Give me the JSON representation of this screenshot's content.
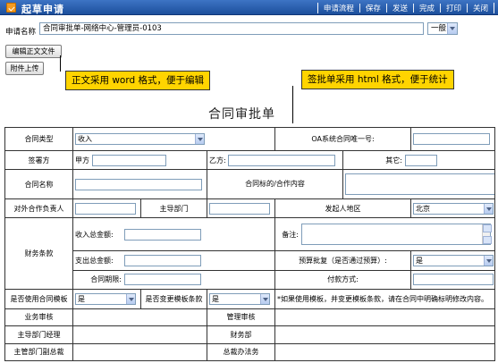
{
  "window": {
    "title": "起草申请"
  },
  "toolbar": {
    "items": [
      "申请流程",
      "保存",
      "发送",
      "完成",
      "打印",
      "关闭"
    ]
  },
  "header": {
    "app_name_label": "申请名称",
    "app_name_value": "合同审批单-网络中心-管理员-0103",
    "priority_value": "一般"
  },
  "buttons": {
    "edit_doc": "编辑正文文件",
    "attach": "附件上传"
  },
  "callouts": {
    "left": "正文采用 word 格式，便于编辑",
    "right": "签批单采用 html 格式，便于统计"
  },
  "form": {
    "title": "合同审批单",
    "contract_type_label": "合同类型",
    "contract_type_value": "收入",
    "oa_no_label": "OA系统合同唯一号:",
    "signatory_label": "签署方",
    "party_a_label": "甲方",
    "party_b_label": "乙方:",
    "other_label": "其它:",
    "contract_name_label": "合同名称",
    "contract_object_label": "合同标的/合作内容",
    "partner_label": "对外合作负责人",
    "dept_label": "主导部门",
    "region_label": "发起人地区",
    "region_value": "北京",
    "finance_label": "财务条款",
    "income_label": "收入总金额:",
    "remark_label": "备注:",
    "expense_label": "支出总金额:",
    "budget_label": "预算批复（是否通过预算）:",
    "budget_value": "是",
    "period_label": "合同期限:",
    "payment_label": "付款方式:",
    "use_template_label": "是否使用合同模板",
    "use_template_value": "是",
    "change_terms_label": "是否变更模板条款",
    "change_terms_value": "是",
    "template_note": "*如果使用模板，并变更模板条款，请在合同中明确标明修改内容。",
    "biz_review_label": "业务审核",
    "mgmt_review_label": "管理审核",
    "dept_manager_label": "主导部门经理",
    "finance_dept_label": "财务部",
    "dept_deputy_label": "主管部门副总裁",
    "legal_label": "总裁办法务"
  }
}
